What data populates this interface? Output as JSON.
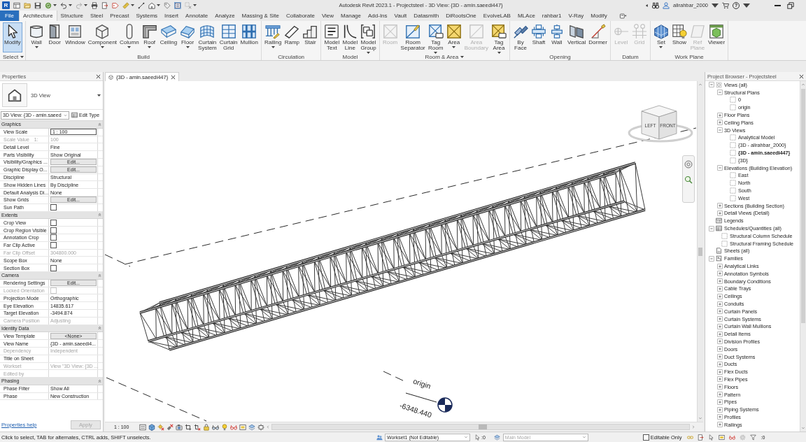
{
  "title_bar": {
    "app_logo": "R",
    "title": "Autodesk Revit 2023.1 - Projectsteel - 3D View: {3D - amin.saeedi447}",
    "user": "alirahbar_2000",
    "help": "?"
  },
  "tabs": [
    {
      "label": "File",
      "kind": "file",
      "selected": false
    },
    {
      "label": "Architecture",
      "kind": "tab",
      "selected": true
    },
    {
      "label": "Structure",
      "kind": "tab",
      "selected": false
    },
    {
      "label": "Steel",
      "kind": "tab",
      "selected": false
    },
    {
      "label": "Precast",
      "kind": "tab",
      "selected": false
    },
    {
      "label": "Systems",
      "kind": "tab",
      "selected": false
    },
    {
      "label": "Insert",
      "kind": "tab",
      "selected": false
    },
    {
      "label": "Annotate",
      "kind": "tab",
      "selected": false
    },
    {
      "label": "Analyze",
      "kind": "tab",
      "selected": false
    },
    {
      "label": "Massing & Site",
      "kind": "tab",
      "selected": false
    },
    {
      "label": "Collaborate",
      "kind": "tab",
      "selected": false
    },
    {
      "label": "View",
      "kind": "tab",
      "selected": false
    },
    {
      "label": "Manage",
      "kind": "tab",
      "selected": false
    },
    {
      "label": "Add-Ins",
      "kind": "tab",
      "selected": false
    },
    {
      "label": "Vault",
      "kind": "tab",
      "selected": false
    },
    {
      "label": "Datasmith",
      "kind": "tab",
      "selected": false
    },
    {
      "label": "DiRootsOne",
      "kind": "tab",
      "selected": false
    },
    {
      "label": "EvolveLAB",
      "kind": "tab",
      "selected": false
    },
    {
      "label": "MLAce",
      "kind": "tab",
      "selected": false
    },
    {
      "label": "rahbar1",
      "kind": "tab",
      "selected": false
    },
    {
      "label": "V-Ray",
      "kind": "tab",
      "selected": false
    },
    {
      "label": "Modify",
      "kind": "tab",
      "selected": false
    }
  ],
  "ribbon": {
    "panels": [
      {
        "title": "Select",
        "menu": true,
        "buttons": [
          {
            "label": "Modify",
            "dropdown": false,
            "disabled": false,
            "selected": true
          }
        ]
      },
      {
        "title": "Build",
        "menu": false,
        "buttons": [
          {
            "label": "Wall",
            "dropdown": true,
            "disabled": false,
            "selected": false
          },
          {
            "label": "Door",
            "dropdown": false,
            "disabled": false,
            "selected": false
          },
          {
            "label": "Window",
            "dropdown": false,
            "disabled": false,
            "selected": false
          },
          {
            "label": "Component",
            "dropdown": true,
            "disabled": false,
            "selected": false
          },
          {
            "label": "Column",
            "dropdown": true,
            "disabled": false,
            "selected": false
          },
          {
            "label": "Roof",
            "dropdown": true,
            "disabled": false,
            "selected": false
          },
          {
            "label": "Ceiling",
            "dropdown": false,
            "disabled": false,
            "selected": false
          },
          {
            "label": "Floor",
            "dropdown": true,
            "disabled": false,
            "selected": false
          },
          {
            "label": "Curtain System",
            "dropdown": false,
            "disabled": false,
            "selected": false
          },
          {
            "label": "Curtain Grid",
            "dropdown": false,
            "disabled": false,
            "selected": false
          },
          {
            "label": "Mullion",
            "dropdown": false,
            "disabled": false,
            "selected": false
          }
        ]
      },
      {
        "title": "Circulation",
        "menu": false,
        "buttons": [
          {
            "label": "Railing",
            "dropdown": true,
            "disabled": false,
            "selected": false
          },
          {
            "label": "Ramp",
            "dropdown": false,
            "disabled": false,
            "selected": false
          },
          {
            "label": "Stair",
            "dropdown": false,
            "disabled": false,
            "selected": false
          }
        ]
      },
      {
        "title": "Model",
        "menu": false,
        "buttons": [
          {
            "label": "Model Text",
            "dropdown": false,
            "disabled": false,
            "selected": false
          },
          {
            "label": "Model Line",
            "dropdown": false,
            "disabled": false,
            "selected": false
          },
          {
            "label": "Model Group",
            "dropdown": true,
            "disabled": false,
            "selected": false
          }
        ]
      },
      {
        "title": "Room & Area",
        "menu": true,
        "buttons": [
          {
            "label": "Room",
            "dropdown": false,
            "disabled": true,
            "selected": false
          },
          {
            "label": "Room Separator",
            "dropdown": false,
            "disabled": false,
            "selected": false
          },
          {
            "label": "Tag Room",
            "dropdown": true,
            "disabled": false,
            "selected": false
          },
          {
            "label": "Area",
            "dropdown": true,
            "disabled": false,
            "selected": false
          },
          {
            "label": "Area Boundary",
            "dropdown": false,
            "disabled": true,
            "selected": false
          },
          {
            "label": "Tag Area",
            "dropdown": true,
            "disabled": false,
            "selected": false
          }
        ]
      },
      {
        "title": "Opening",
        "menu": false,
        "buttons": [
          {
            "label": "By Face",
            "dropdown": false,
            "disabled": false,
            "selected": false
          },
          {
            "label": "Shaft",
            "dropdown": false,
            "disabled": false,
            "selected": false
          },
          {
            "label": "Wall",
            "dropdown": false,
            "disabled": false,
            "selected": false
          },
          {
            "label": "Vertical",
            "dropdown": false,
            "disabled": false,
            "selected": false
          },
          {
            "label": "Dormer",
            "dropdown": false,
            "disabled": false,
            "selected": false
          }
        ]
      },
      {
        "title": "Datum",
        "menu": false,
        "buttons": [
          {
            "label": "Level",
            "dropdown": false,
            "disabled": true,
            "selected": false
          },
          {
            "label": "Grid",
            "dropdown": false,
            "disabled": true,
            "selected": false
          }
        ]
      },
      {
        "title": "Work Plane",
        "menu": false,
        "buttons": [
          {
            "label": "Set",
            "dropdown": true,
            "disabled": false,
            "selected": false
          },
          {
            "label": "Show",
            "dropdown": false,
            "disabled": false,
            "selected": false
          },
          {
            "label": "Ref Plane",
            "dropdown": false,
            "disabled": true,
            "selected": false
          },
          {
            "label": "Viewer",
            "dropdown": false,
            "disabled": false,
            "selected": false
          }
        ]
      }
    ]
  },
  "properties": {
    "title": "Properties",
    "type_name": "3D View",
    "view_selector": "3D View: {3D - amin.saeed",
    "edit_type": "Edit Type",
    "groups": [
      {
        "name": "Graphics",
        "expanded": true,
        "rows": [
          {
            "label": "View Scale",
            "kind": "field",
            "value": "1 : 100",
            "disabled": false
          },
          {
            "label": "Scale Value",
            "unit": "1:",
            "kind": "text",
            "value": "100",
            "disabled": true
          },
          {
            "label": "Detail Level",
            "kind": "text",
            "value": "Fine",
            "disabled": false
          },
          {
            "label": "Parts Visibility",
            "kind": "text",
            "value": "Show Original",
            "disabled": false
          },
          {
            "label": "Visibility/Graphics ...",
            "kind": "button",
            "value": "Edit...",
            "disabled": false
          },
          {
            "label": "Graphic Display O...",
            "kind": "button",
            "value": "Edit...",
            "disabled": false
          },
          {
            "label": "Discipline",
            "kind": "text",
            "value": "Structural",
            "disabled": false
          },
          {
            "label": "Show Hidden Lines",
            "kind": "text",
            "value": "By Discipline",
            "disabled": false
          },
          {
            "label": "Default Analysis Di...",
            "kind": "text",
            "value": "None",
            "disabled": false
          },
          {
            "label": "Show Grids",
            "kind": "button",
            "value": "Edit...",
            "disabled": false
          },
          {
            "label": "Sun Path",
            "kind": "checkbox",
            "checked": false,
            "disabled": false
          }
        ]
      },
      {
        "name": "Extents",
        "expanded": true,
        "rows": [
          {
            "label": "Crop View",
            "kind": "checkbox",
            "checked": false,
            "disabled": false
          },
          {
            "label": "Crop Region Visible",
            "kind": "checkbox",
            "checked": false,
            "disabled": false
          },
          {
            "label": "Annotation Crop",
            "kind": "checkbox",
            "checked": false,
            "disabled": false
          },
          {
            "label": "Far Clip Active",
            "kind": "checkbox",
            "checked": false,
            "disabled": false
          },
          {
            "label": "Far Clip Offset",
            "kind": "text",
            "value": "304800.000",
            "disabled": true
          },
          {
            "label": "Scope Box",
            "kind": "text",
            "value": "None",
            "disabled": false
          },
          {
            "label": "Section Box",
            "kind": "checkbox",
            "checked": false,
            "disabled": false
          }
        ]
      },
      {
        "name": "Camera",
        "expanded": true,
        "rows": [
          {
            "label": "Rendering Settings",
            "kind": "button",
            "value": "Edit...",
            "disabled": false
          },
          {
            "label": "Locked Orientation",
            "kind": "checkbox",
            "checked": false,
            "disabled": true
          },
          {
            "label": "Projection Mode",
            "kind": "text",
            "value": "Orthographic",
            "disabled": false
          },
          {
            "label": "Eye Elevation",
            "kind": "text",
            "value": "14835.617",
            "disabled": false
          },
          {
            "label": "Target Elevation",
            "kind": "text",
            "value": "-3494.874",
            "disabled": false
          },
          {
            "label": "Camera Position",
            "kind": "text",
            "value": "Adjusting",
            "disabled": true
          }
        ]
      },
      {
        "name": "Identity Data",
        "expanded": true,
        "rows": [
          {
            "label": "View Template",
            "kind": "button",
            "value": "<None>",
            "disabled": false
          },
          {
            "label": "View Name",
            "kind": "text",
            "value": "{3D - amin.saeedi4...",
            "disabled": false
          },
          {
            "label": "Dependency",
            "kind": "text",
            "value": "Independent",
            "disabled": true
          },
          {
            "label": "Title on Sheet",
            "kind": "text",
            "disabled": false
          },
          {
            "label": "Workset",
            "kind": "text",
            "value": "View \"3D View: {3D ...",
            "disabled": true
          },
          {
            "label": "Edited by",
            "kind": "text",
            "disabled": true
          }
        ]
      },
      {
        "name": "Phasing",
        "expanded": true,
        "rows": [
          {
            "label": "Phase Filter",
            "kind": "text",
            "value": "Show All",
            "disabled": false
          },
          {
            "label": "Phase",
            "kind": "text",
            "value": "New Construction",
            "disabled": false
          }
        ]
      }
    ],
    "help": "Properties help",
    "apply": {
      "label": "Apply",
      "disabled": true
    }
  },
  "view": {
    "tab": "{3D - amin.saeedi447}",
    "view_cube": [
      "LEFT",
      "FRONT"
    ],
    "level": {
      "name": "origin",
      "elevation": "-6348.440"
    },
    "scale": "1 : 100"
  },
  "project_browser": {
    "title": "Project Browser - Projectsteel",
    "tree": [
      {
        "label": "Views (all)",
        "kind": "views",
        "expanded": true,
        "selected": false,
        "children": [
          {
            "label": "Structural Plans",
            "kind": "folder",
            "expanded": true,
            "selected": false,
            "children": [
              {
                "label": "0",
                "kind": "view",
                "selected": false
              },
              {
                "label": "origin",
                "kind": "view",
                "selected": false
              }
            ]
          },
          {
            "label": "Floor Plans",
            "kind": "folder",
            "expanded": false,
            "selected": false
          },
          {
            "label": "Ceiling Plans",
            "kind": "folder",
            "expanded": false,
            "selected": false
          },
          {
            "label": "3D Views",
            "kind": "folder",
            "expanded": true,
            "selected": false,
            "children": [
              {
                "label": "Analytical Model",
                "kind": "view",
                "selected": false
              },
              {
                "label": "{3D - alirahbar_2000}",
                "kind": "view",
                "selected": false
              },
              {
                "label": "{3D - amin.saeedi447}",
                "kind": "view",
                "selected": true
              },
              {
                "label": "{3D}",
                "kind": "view",
                "selected": false
              }
            ]
          },
          {
            "label": "Elevations (Building Elevation)",
            "kind": "folder",
            "expanded": true,
            "selected": false,
            "children": [
              {
                "label": "East",
                "kind": "view",
                "selected": false
              },
              {
                "label": "North",
                "kind": "view",
                "selected": false
              },
              {
                "label": "South",
                "kind": "view",
                "selected": false
              },
              {
                "label": "West",
                "kind": "view",
                "selected": false
              }
            ]
          },
          {
            "label": "Sections (Building Section)",
            "kind": "folder",
            "expanded": false,
            "selected": false
          },
          {
            "label": "Detail Views (Detail)",
            "kind": "folder",
            "expanded": false,
            "selected": false
          }
        ]
      },
      {
        "label": "Legends",
        "kind": "legends",
        "selected": false
      },
      {
        "label": "Schedules/Quantities (all)",
        "kind": "schedules",
        "expanded": true,
        "selected": false,
        "children": [
          {
            "label": "Structural Column Schedule",
            "kind": "view",
            "selected": false
          },
          {
            "label": "Structural Framing Schedule",
            "kind": "view",
            "selected": false
          }
        ]
      },
      {
        "label": "Sheets (all)",
        "kind": "sheets",
        "selected": false
      },
      {
        "label": "Families",
        "kind": "families",
        "expanded": true,
        "selected": false,
        "children": [
          {
            "label": "Analytical Links",
            "kind": "folder",
            "expanded": false,
            "selected": false
          },
          {
            "label": "Annotation Symbols",
            "kind": "folder",
            "expanded": false,
            "selected": false
          },
          {
            "label": "Boundary Conditions",
            "kind": "folder",
            "expanded": false,
            "selected": false
          },
          {
            "label": "Cable Trays",
            "kind": "folder",
            "expanded": false,
            "selected": false
          },
          {
            "label": "Ceilings",
            "kind": "folder",
            "expanded": false,
            "selected": false
          },
          {
            "label": "Conduits",
            "kind": "folder",
            "expanded": false,
            "selected": false
          },
          {
            "label": "Curtain Panels",
            "kind": "folder",
            "expanded": false,
            "selected": false
          },
          {
            "label": "Curtain Systems",
            "kind": "folder",
            "expanded": false,
            "selected": false
          },
          {
            "label": "Curtain Wall Mullions",
            "kind": "folder",
            "expanded": false,
            "selected": false
          },
          {
            "label": "Detail Items",
            "kind": "folder",
            "expanded": false,
            "selected": false
          },
          {
            "label": "Division Profiles",
            "kind": "folder",
            "expanded": false,
            "selected": false
          },
          {
            "label": "Doors",
            "kind": "folder",
            "expanded": false,
            "selected": false
          },
          {
            "label": "Duct Systems",
            "kind": "folder",
            "expanded": false,
            "selected": false
          },
          {
            "label": "Ducts",
            "kind": "folder",
            "expanded": false,
            "selected": false
          },
          {
            "label": "Flex Ducts",
            "kind": "folder",
            "expanded": false,
            "selected": false
          },
          {
            "label": "Flex Pipes",
            "kind": "folder",
            "expanded": false,
            "selected": false
          },
          {
            "label": "Floors",
            "kind": "folder",
            "expanded": false,
            "selected": false
          },
          {
            "label": "Pattern",
            "kind": "folder",
            "expanded": false,
            "selected": false
          },
          {
            "label": "Pipes",
            "kind": "folder",
            "expanded": false,
            "selected": false
          },
          {
            "label": "Piping Systems",
            "kind": "folder",
            "expanded": false,
            "selected": false
          },
          {
            "label": "Profiles",
            "kind": "folder",
            "expanded": false,
            "selected": false
          },
          {
            "label": "Railings",
            "kind": "folder",
            "expanded": false,
            "selected": false
          }
        ]
      }
    ]
  },
  "status_bar": {
    "message": "Click to select, TAB for alternates, CTRL adds, SHIFT unselects.",
    "workset": "Workset1 (Not Editable)",
    "selection_count": ":0",
    "design_option": {
      "label": "Main Model",
      "disabled": true
    },
    "editable_only": {
      "label": "Editable Only",
      "checked": false
    },
    "filter_count": ":0"
  }
}
